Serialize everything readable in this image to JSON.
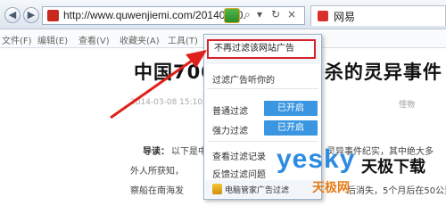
{
  "address_bar": {
    "back_glyph": "◀",
    "forward_glyph": "▶",
    "url": "http://www.quwenjiemi.com/20140220.",
    "plugin_icon": "shield-filter-icon",
    "search_glyph": "⌕",
    "dropdown_glyph": "▾",
    "refresh_glyph": "↻",
    "close_glyph": "×",
    "tab_label": "网易"
  },
  "menu": {
    "items": [
      "文件(F)",
      "编辑(E)",
      "查看(V)",
      "收藏夹(A)",
      "工具(T)",
      "帮助(H)"
    ]
  },
  "article": {
    "title_left": "中国700",
    "title_right": "杀的灵异事件",
    "date": "2014-03-08 15:10",
    "tag": "怪物",
    "summary_label": "导读：",
    "lines": [
      "以下是中",
      "外人所获知，",
      "察船在南海发"
    ],
    "right_lines": [
      "灵异事件纪实，其中绝大多",
      "后消失，5个月后在50公里"
    ]
  },
  "popup": {
    "stop_filter": "不再过滤该网站广告",
    "filter_ad": "过滤广告听你的",
    "normal_filter": "普通过滤",
    "normal_filter_state": "已开启",
    "strong_filter": "强力过滤",
    "strong_filter_state": "已开启",
    "view_records": "查看过滤记录",
    "report_issue": "反馈过滤问题",
    "footer": "电脑管家广告过滤"
  },
  "watermark": {
    "brand": "yesky",
    "brand_cn": "天极下载",
    "sub": "天极网"
  },
  "colors": {
    "highlight_red": "#d7232a",
    "toggle_blue": "#3a96e0",
    "watermark_blue": "#2d8be0",
    "watermark_orange": "#e87c17"
  }
}
